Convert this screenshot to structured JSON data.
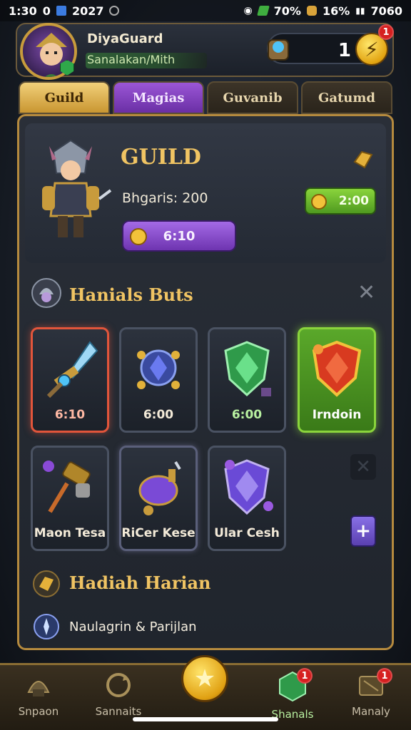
{
  "status_bar": {
    "time": "1:30",
    "left_extra": "0",
    "left_year": "2027",
    "battery_pct": "70%",
    "gold_stat": "16%",
    "right_value": "7060"
  },
  "header": {
    "player_name": "DiyaGuard",
    "player_subtitle": "Sanalakan/Mith",
    "currency_value": "1",
    "currency_add_icon": "lightning-icon",
    "notif_count": "1"
  },
  "tabs": [
    {
      "label": "Guild"
    },
    {
      "label": "Magias"
    },
    {
      "label": "Guvanib"
    },
    {
      "label": "Gatumd"
    }
  ],
  "guild": {
    "title": "GUILD",
    "info": "Bhgaris: 200",
    "timer": "6:10",
    "reward": "2:00"
  },
  "items_section": {
    "title": "Hanials Buts",
    "row1": [
      {
        "label": "6:10",
        "color": "#e2553b"
      },
      {
        "label": "6:00",
        "color": "#4a5262"
      },
      {
        "label": "6:00",
        "color": "#4a5262"
      },
      {
        "label": "Irndoin",
        "color": "#8ad43c"
      }
    ],
    "row2": [
      {
        "label": "Maon Tesa",
        "color": "#4a5262"
      },
      {
        "label": "RiCer Kese",
        "color": "#5a5f7a"
      },
      {
        "label": "Ular Cesh",
        "color": "#4a5262"
      }
    ],
    "add_label": "+"
  },
  "daily": {
    "title": "Hadiah Harian",
    "line": "Naulagrin & Parijlan"
  },
  "bottom_nav": [
    {
      "label": "Snpaon"
    },
    {
      "label": "Sannaits"
    },
    {
      "label": ""
    },
    {
      "label": "Shanals",
      "badge": "1"
    },
    {
      "label": "Manaly",
      "badge": "1"
    }
  ]
}
